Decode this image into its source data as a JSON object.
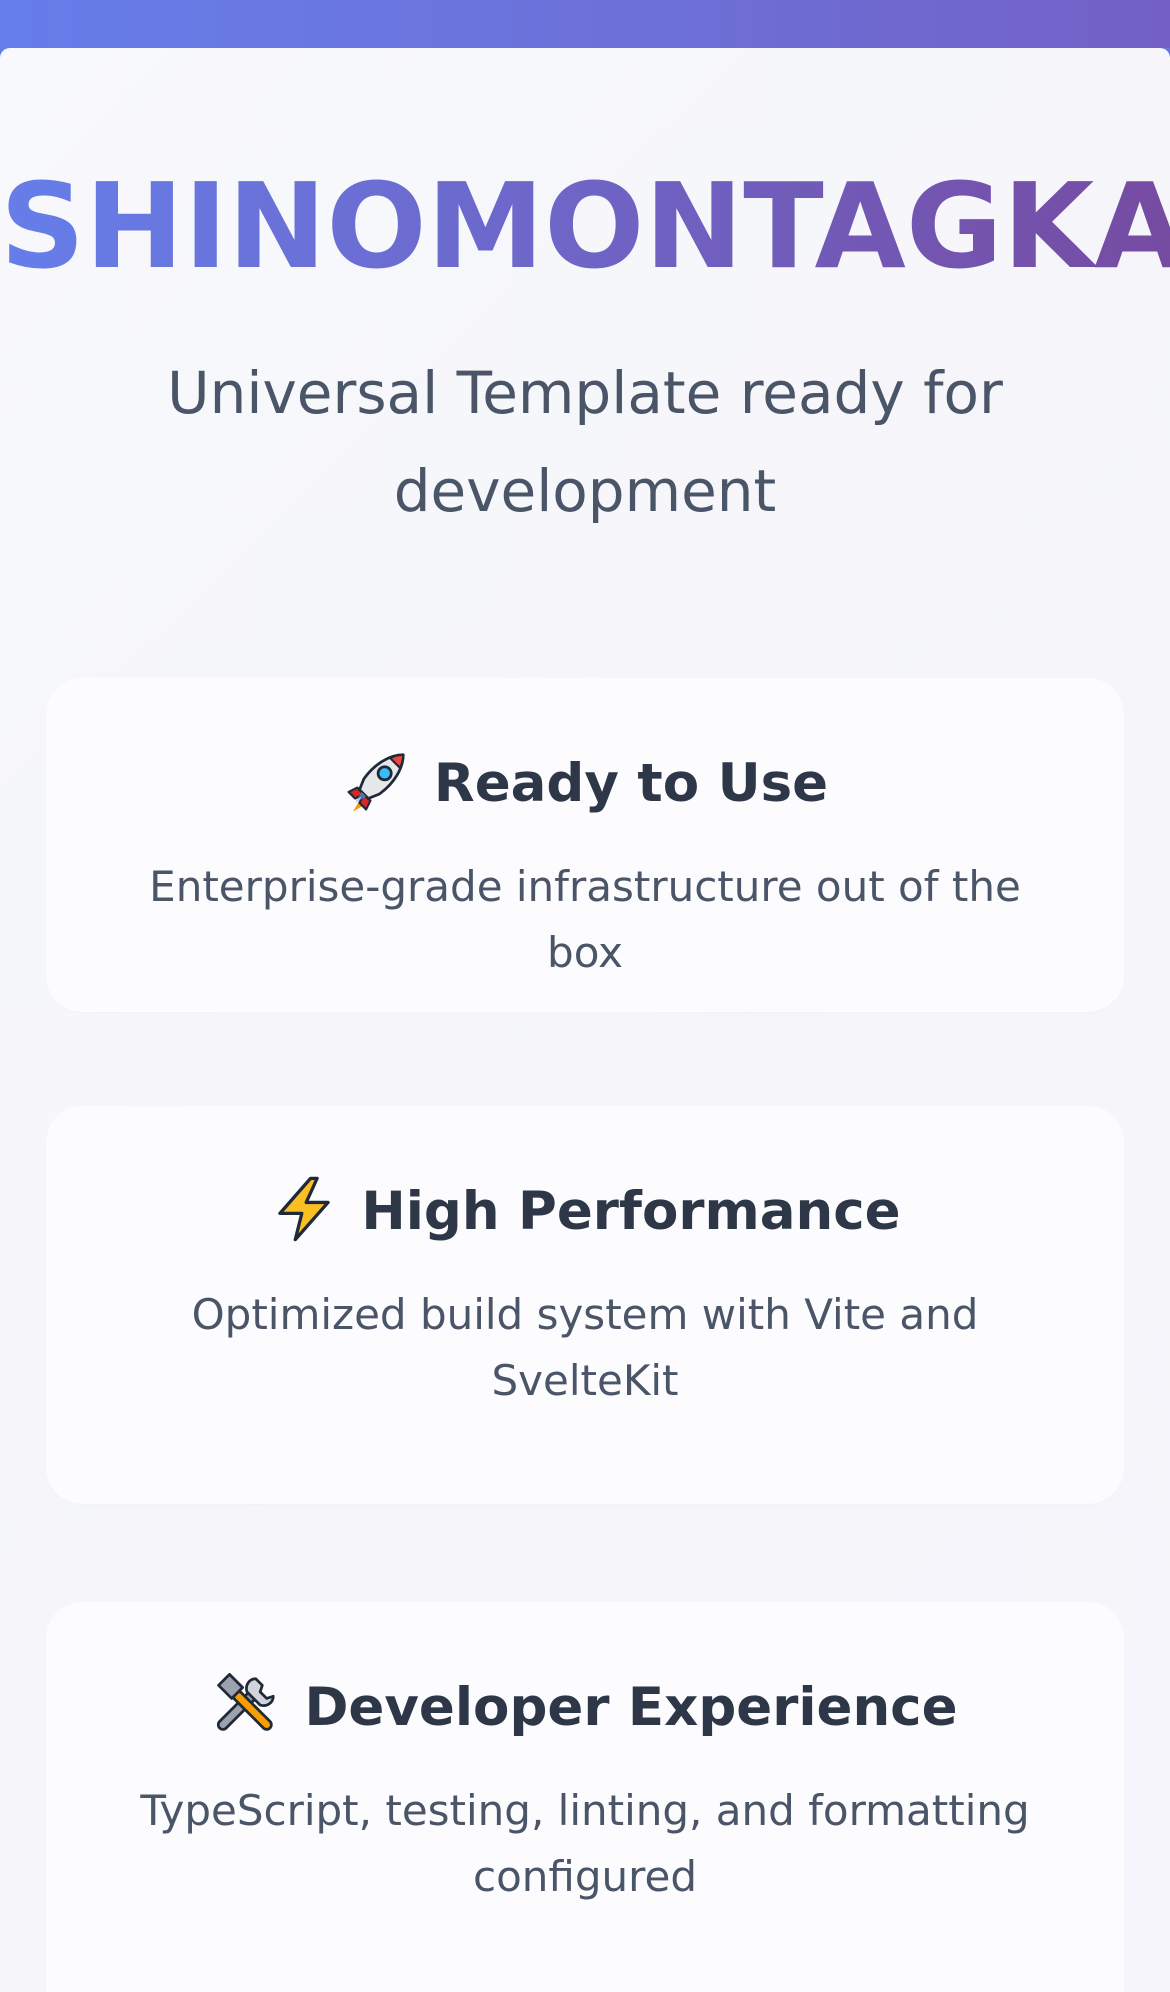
{
  "page": {
    "title": "SHINOMONTAGKA",
    "subtitle": "Universal Template ready for development"
  },
  "features": [
    {
      "icon": "rocket-icon",
      "title": "Ready to Use",
      "description": "Enterprise-grade infrastructure out of the box"
    },
    {
      "icon": "lightning-icon",
      "title": "High Performance",
      "description": "Optimized build system with Vite and SvelteKit"
    },
    {
      "icon": "tools-icon",
      "title": "Developer Experience",
      "description": "TypeScript, testing, linting, and formatting configured"
    }
  ],
  "colors": {
    "gradient_start": "#667eea",
    "gradient_end": "#764ba2",
    "heading_text": "#2d3748",
    "body_text": "#4a5568",
    "panel_background": "#f8f9fc",
    "card_background": "#fcfcfe"
  }
}
